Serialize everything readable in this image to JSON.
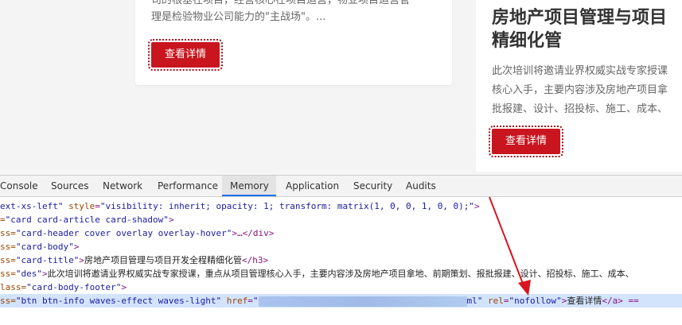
{
  "left_card": {
    "desc_line1": "司的根基在项目，经营核心在项目运营，物业项目运营管",
    "desc_line2": "理是检验物业公司能力的\"主战场\"。...",
    "button_label": "查看详情"
  },
  "right_card": {
    "title_line1": "房地产项目管理与项目",
    "title_line2": "精细化管",
    "desc_line1": "此次培训将邀请业界权威实战专家授课",
    "desc_line2": "核心入手，主要内容涉及房地产项目拿",
    "desc_line3": "批报建、设计、招投标、施工、成本、",
    "button_label": "查看详情"
  },
  "devtools": {
    "tabs": [
      {
        "label": "Console"
      },
      {
        "label": "Sources"
      },
      {
        "label": "Network"
      },
      {
        "label": "Performance"
      },
      {
        "label": "Memory"
      },
      {
        "label": "Application"
      },
      {
        "label": "Security"
      },
      {
        "label": "Audits"
      }
    ],
    "active_tab": "Memory",
    "code": {
      "l1_a": "ext-xs-left\" ",
      "l1_attr": "style",
      "l1_val": "\"visibility: inherit; opacity: 1; transform: matrix(1, 0, 0, 1, 0, 0);\"",
      "l1_end": ">",
      "l2_pre": "=",
      "l2_val": "\"card card-article card-shadow\"",
      "l2_end": ">",
      "l3_pre": "ss=",
      "l3_val": "\"card-header cover overlay overlay-hover\"",
      "l3_end": ">…</div>",
      "l4_pre": "ss=",
      "l4_val": "\"card-body\"",
      "l4_end": ">",
      "l5_pre": "ss=",
      "l5_val": "\"card-title\"",
      "l5_gt": ">",
      "l5_text": "房地产项目管理与项目开发全程精细化管",
      "l5_close": "</h3>",
      "l6_pre": "ss=",
      "l6_val": "\"des\"",
      "l6_gt": ">",
      "l6_text": "此次培训将邀请业界权威实战专家授课，重点从项目管理核心入手，主要内容涉及房地产项目拿地、前期策划、报批报建、设计、招投标、施工、成本、",
      "l7_pre": "lass=",
      "l7_val": "\"card-body-footer\"",
      "l7_end": ">",
      "l8_pre": "ss=",
      "l8_val": "\"btn btn-info waves-effect waves-light\"",
      "l8_href": " href",
      "l8_eq": "=",
      "l8_q": "\"",
      "l8_tail": "ml\"",
      "l8_rel": " rel",
      "l8_relval": "\"nofollow\"",
      "l8_gt": ">",
      "l8_text": "查看详情",
      "l8_close": "</a>",
      "l8_suffix": " =="
    }
  }
}
